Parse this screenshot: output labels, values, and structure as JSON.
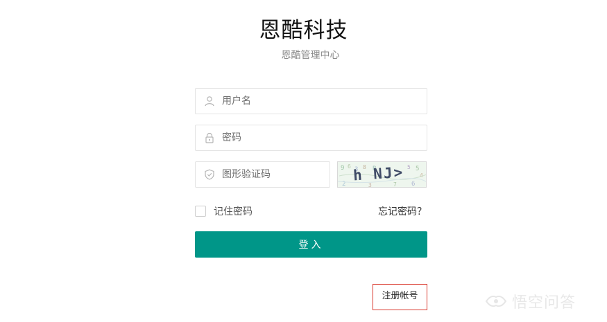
{
  "header": {
    "title": "恩酷科技",
    "subtitle": "恩酷管理中心"
  },
  "form": {
    "username": {
      "placeholder": "用户名",
      "value": "",
      "icon": "user-icon"
    },
    "password": {
      "placeholder": "密码",
      "value": "",
      "icon": "lock-icon"
    },
    "captcha": {
      "placeholder": "图形验证码",
      "value": "",
      "icon": "shield-icon",
      "image_text": "h NJ>"
    },
    "remember": {
      "label": "记住密码",
      "checked": false
    },
    "forgot_label": "忘记密码？",
    "login_label": "登入",
    "register_label": "注册帐号"
  },
  "watermark": {
    "text": "悟空问答"
  },
  "colors": {
    "primary": "#009688",
    "register_border": "#d9362b",
    "field_border": "#e3e3e3"
  }
}
